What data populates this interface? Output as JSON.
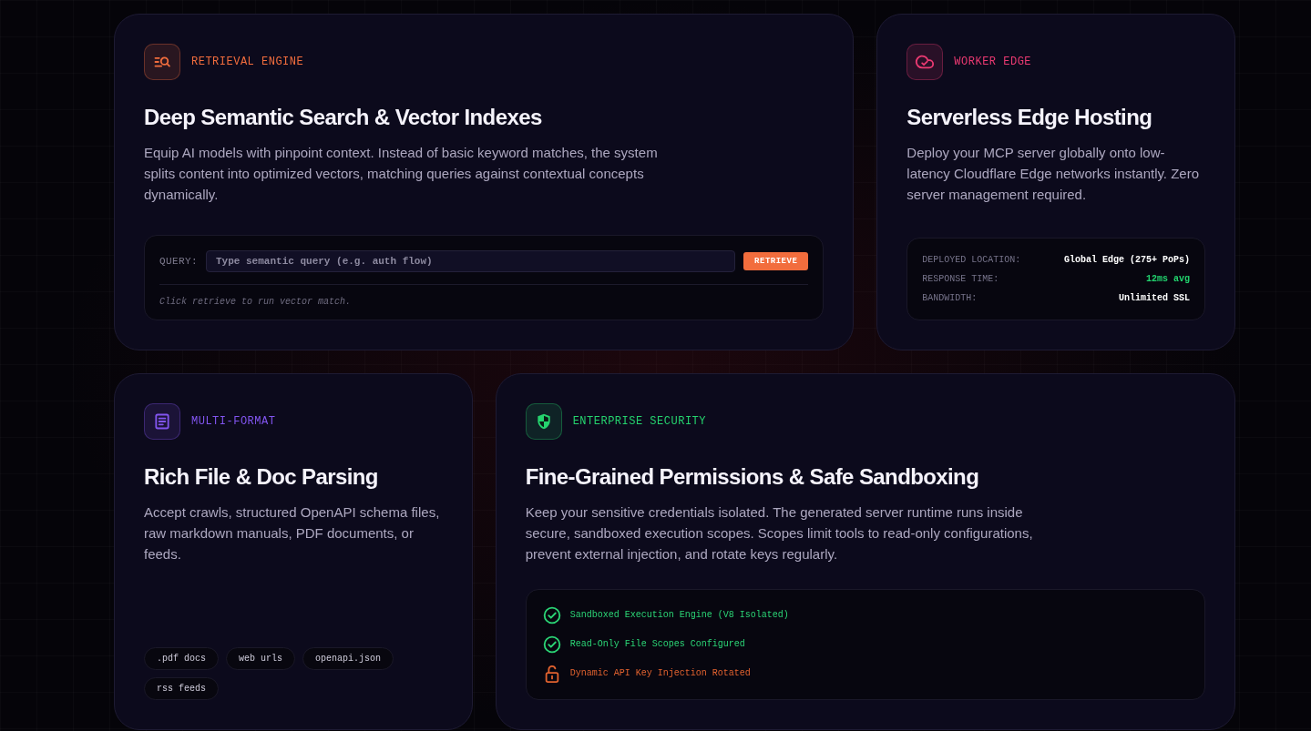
{
  "cards": [
    {
      "kind": "query",
      "color": "#f26d3d",
      "label": "RETRIEVAL ENGINE",
      "title": "Deep Semantic Search & Vector Indexes",
      "description": "Equip AI models with pinpoint context. Instead of basic keyword matches, the system splits content into optimized vectors, matching queries against contextual concepts dynamically.",
      "query": {
        "label": "QUERY:",
        "placeholder": "Type semantic query (e.g. auth flow)",
        "button": "RETRIEVE",
        "hint": "Click retrieve to run vector match."
      }
    },
    {
      "kind": "stats",
      "color": "#ec3a72",
      "label": "WORKER EDGE",
      "title": "Serverless Edge Hosting",
      "description": "Deploy your MCP server globally onto low-latency Cloudflare Edge networks instantly. Zero server management required.",
      "stats": [
        {
          "label": "DEPLOYED LOCATION:",
          "value": "Global Edge (275+ PoPs)",
          "color": "#ffffff"
        },
        {
          "label": "RESPONSE TIME:",
          "value": "12ms avg",
          "color": "#22d36e"
        },
        {
          "label": "BANDWIDTH:",
          "value": "Unlimited SSL",
          "color": "#ffffff"
        }
      ]
    },
    {
      "kind": "tags",
      "color": "#8255f0",
      "label": "MULTI-FORMAT",
      "title": "Rich File & Doc Parsing",
      "description": "Accept crawls, structured OpenAPI schema files, raw markdown manuals, PDF documents, or feeds.",
      "tags": [
        ".pdf docs",
        "web urls",
        "openapi.json",
        "rss feeds"
      ]
    },
    {
      "kind": "checklist",
      "color": "#25d36e",
      "label": "ENTERPRISE SECURITY",
      "title": "Fine-Grained Permissions & Safe Sandboxing",
      "description": "Keep your sensitive credentials isolated. The generated server runtime runs inside secure, sandboxed execution scopes. Scopes limit tools to read-only configurations, prevent external injection, and rotate keys regularly.",
      "checks": [
        {
          "text": "Sandboxed Execution Engine (V8 Isolated)",
          "passed": true
        },
        {
          "text": "Read-Only File Scopes Configured",
          "passed": true
        },
        {
          "text": "Dynamic API Key Injection Rotated",
          "passed": false
        }
      ]
    }
  ]
}
